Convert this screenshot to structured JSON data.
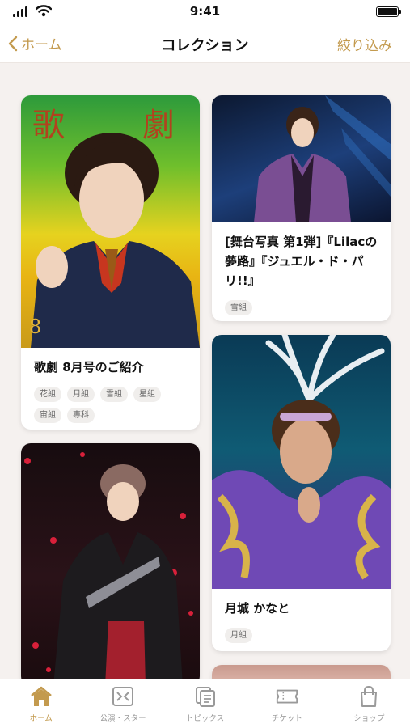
{
  "status_bar": {
    "time": "9:41"
  },
  "nav": {
    "back_label": "ホーム",
    "title": "コレクション",
    "filter_label": "絞り込み"
  },
  "cards": [
    {
      "title": "歌劇 8月号のご紹介",
      "tags": [
        "花組",
        "月組",
        "雪組",
        "星組",
        "宙組",
        "専科"
      ]
    },
    {
      "title": "[舞台写真 第1弾]『Lilacの夢路』『ジュエル・ド・パリ!!』",
      "tags": [
        "雪組"
      ]
    },
    {
      "title": "月城 かなと",
      "tags": [
        "月組"
      ]
    }
  ],
  "magazine_cover": {
    "masthead": "歌劇",
    "issue": "8"
  },
  "tab_bar": {
    "items": [
      {
        "label": "ホーム",
        "icon": "home-icon",
        "active": true
      },
      {
        "label": "公演・スター",
        "icon": "performance-icon",
        "active": false
      },
      {
        "label": "トピックス",
        "icon": "topics-icon",
        "active": false
      },
      {
        "label": "チケット",
        "icon": "ticket-icon",
        "active": false
      },
      {
        "label": "ショップ",
        "icon": "shop-icon",
        "active": false
      }
    ]
  },
  "colors": {
    "accent": "#c39a4e",
    "background": "#f5f1ef",
    "card": "#ffffff",
    "inactive_tab": "#9a9a9a"
  }
}
